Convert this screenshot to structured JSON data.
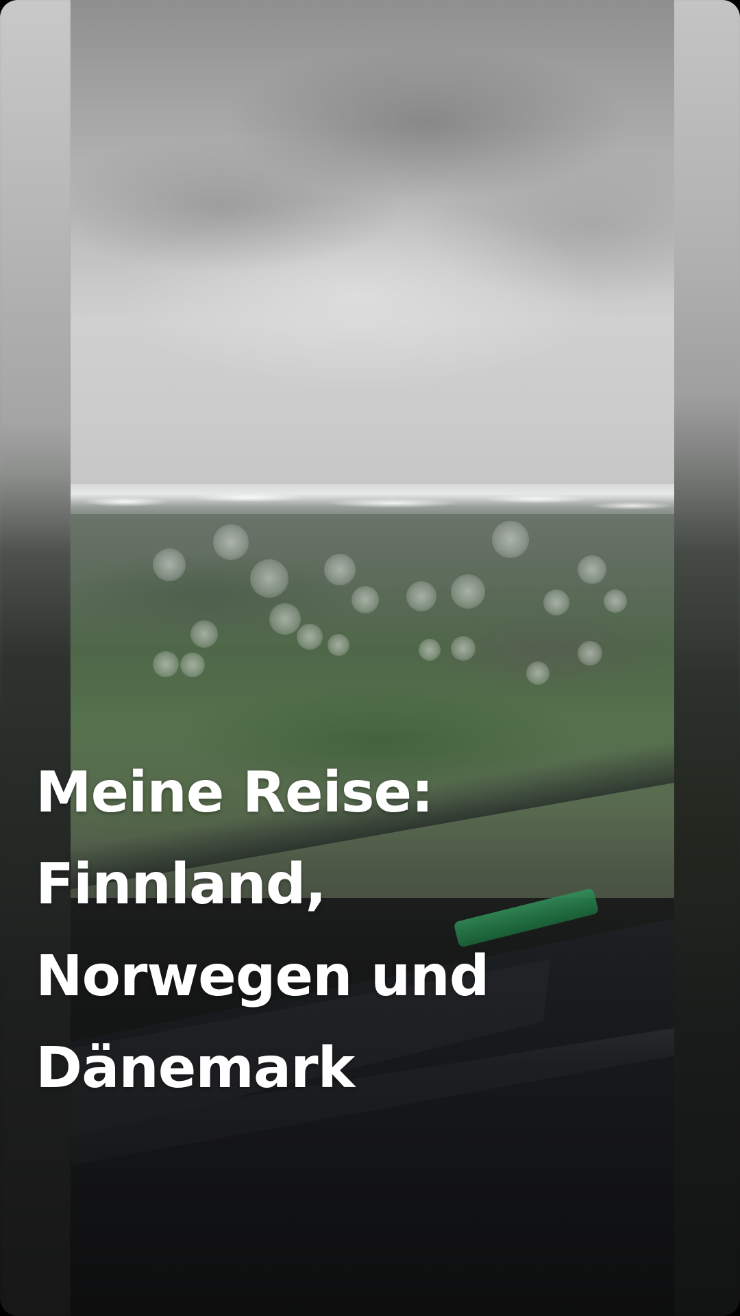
{
  "story": {
    "title_lines": [
      "Meine Reise:",
      "Finnland,",
      "Norwegen und",
      "Dänemark"
    ]
  },
  "media": {
    "scene": "rainy car windshield view of green tundra hills with snow patches under overcast sky"
  },
  "colors": {
    "title_text": "#ffffff",
    "page_background": "#000000"
  }
}
